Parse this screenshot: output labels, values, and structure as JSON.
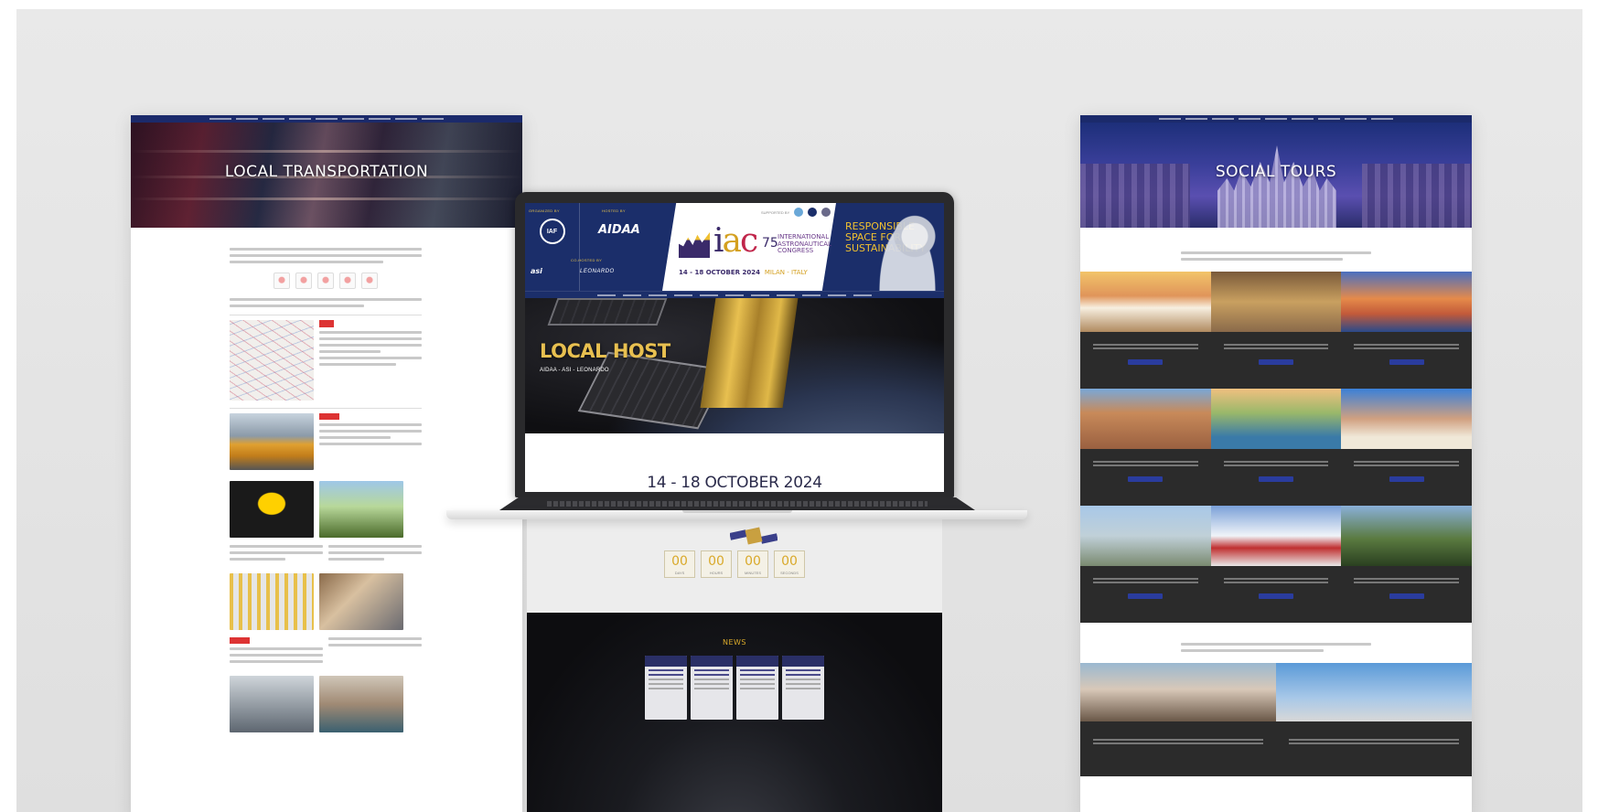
{
  "left_page": {
    "hero_title": "LOCAL TRANSPORTATION"
  },
  "right_page": {
    "hero_title": "SOCIAL TOURS"
  },
  "laptop_site": {
    "header": {
      "organized_by": "ORGANIZED BY",
      "hosted_by": "HOSTED BY",
      "co_hosted_by": "CO-HOSTED BY",
      "iaf_logo": "IAF",
      "aidaa_logo": "AIDAA",
      "asi_logo": "asi",
      "leonardo_logo": "LEONARDO",
      "supported_by": "SUPPORTED BY",
      "iac_letters": {
        "i": "i",
        "a": "a",
        "c": "c"
      },
      "iac_number": "75",
      "congress_name_1": "INTERNATIONAL",
      "congress_name_2": "ASTRONAUTICAL",
      "congress_name_3": "CONGRESS",
      "dates": "14 - 18 OCTOBER 2024",
      "city": "MILAN - ITALY",
      "slogan_1": "RESPONSIBLE",
      "slogan_2": "SPACE FOR",
      "slogan_3": "SUSTAINABILITY"
    },
    "hero": {
      "title": "LOCAL HOST",
      "subtitle": "AIDAA - ASI - LEONARDO"
    },
    "event_date": "14 - 18 OCTOBER 2024"
  },
  "center_page": {
    "countdown": [
      {
        "value": "00",
        "label": "DAYS"
      },
      {
        "value": "00",
        "label": "HOURS"
      },
      {
        "value": "00",
        "label": "MINUTES"
      },
      {
        "value": "00",
        "label": "SECONDS"
      }
    ],
    "news_title": "NEWS"
  },
  "colors": {
    "navy": "#1b2e6a",
    "gold": "#e8c050",
    "magenta": "#c0254a",
    "dark_panel": "#2b2b2b"
  }
}
